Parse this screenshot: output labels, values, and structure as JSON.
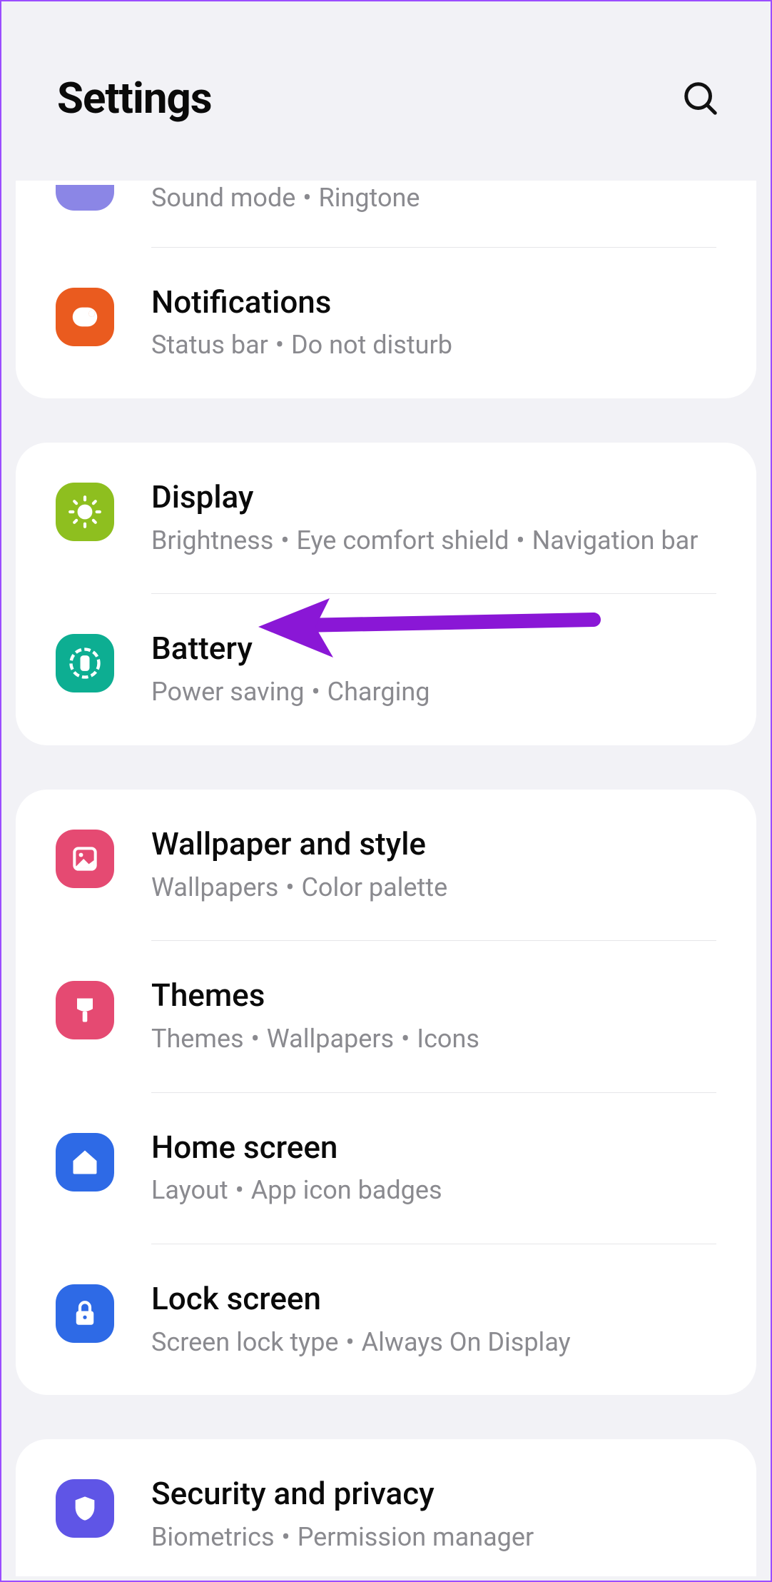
{
  "header": {
    "title": "Settings"
  },
  "groups": [
    {
      "items": [
        {
          "id": "sounds",
          "partial": true,
          "subtitle": [
            "Sound mode",
            "Ringtone"
          ]
        },
        {
          "id": "notifications",
          "title": "Notifications",
          "subtitle": [
            "Status bar",
            "Do not disturb"
          ],
          "icon_color": "#ea5b1f"
        }
      ]
    },
    {
      "items": [
        {
          "id": "display",
          "title": "Display",
          "subtitle": [
            "Brightness",
            "Eye comfort shield",
            "Navigation bar"
          ],
          "icon_color": "#8ebf1f"
        },
        {
          "id": "battery",
          "title": "Battery",
          "subtitle": [
            "Power saving",
            "Charging"
          ],
          "icon_color": "#0dae92"
        }
      ]
    },
    {
      "items": [
        {
          "id": "wallpaper",
          "title": "Wallpaper and style",
          "subtitle": [
            "Wallpapers",
            "Color palette"
          ],
          "icon_color": "#e54a72"
        },
        {
          "id": "themes",
          "title": "Themes",
          "subtitle": [
            "Themes",
            "Wallpapers",
            "Icons"
          ],
          "icon_color": "#e54a72"
        },
        {
          "id": "homescreen",
          "title": "Home screen",
          "subtitle": [
            "Layout",
            "App icon badges"
          ],
          "icon_color": "#2e6ae6"
        },
        {
          "id": "lockscreen",
          "title": "Lock screen",
          "subtitle": [
            "Screen lock type",
            "Always On Display"
          ],
          "icon_color": "#2e6ae6"
        }
      ]
    },
    {
      "items": [
        {
          "id": "security",
          "title": "Security and privacy",
          "subtitle": [
            "Biometrics",
            "Permission manager"
          ],
          "icon_color": "#5f55e6"
        }
      ]
    }
  ],
  "annotation": {
    "target": "battery",
    "color": "#8a17d6"
  }
}
